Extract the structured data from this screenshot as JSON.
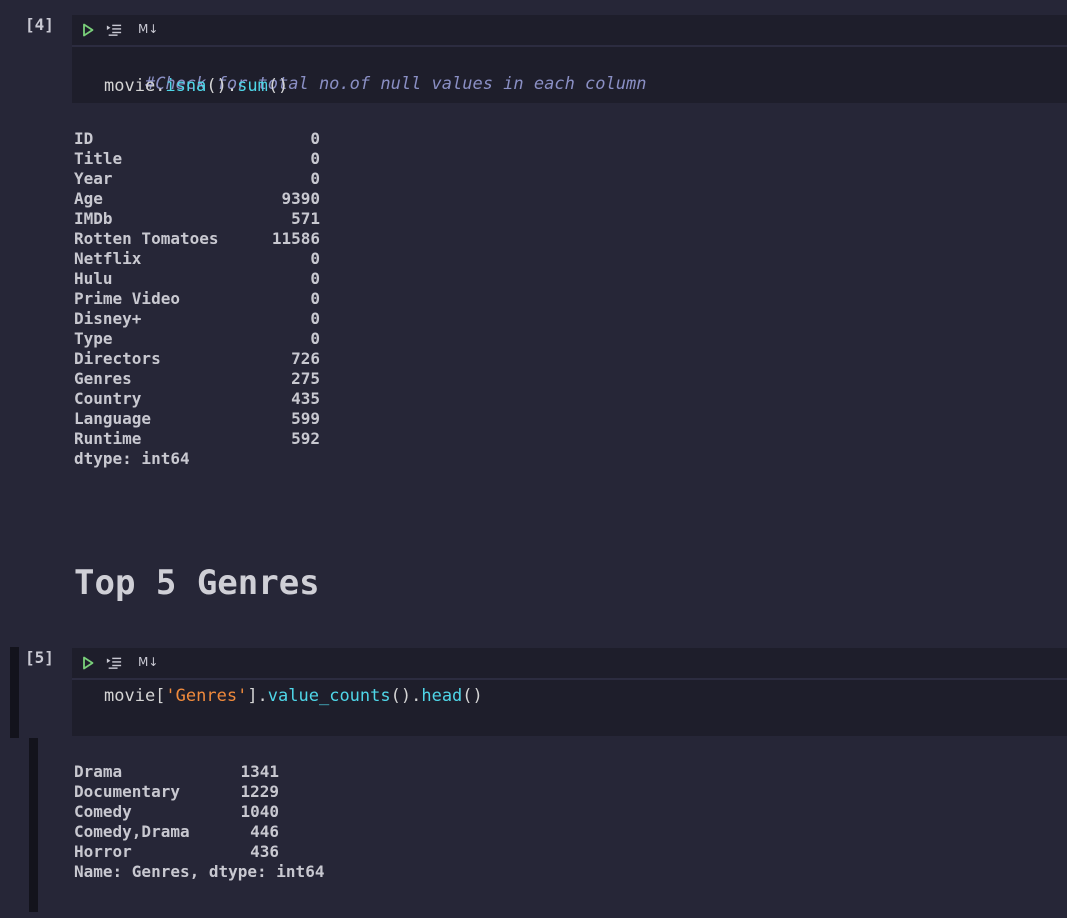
{
  "cells": [
    {
      "prompt": "[4]",
      "toolbar": {
        "md_label": "M↓"
      },
      "code": {
        "comment": "#Check for total no.of null values in each column",
        "line2": {
          "obj": "movie.",
          "fn1": "isna",
          "mid": "().",
          "fn2": "sum",
          "end": "()"
        }
      },
      "output": {
        "rows": [
          {
            "name": "ID",
            "value": "0"
          },
          {
            "name": "Title",
            "value": "0"
          },
          {
            "name": "Year",
            "value": "0"
          },
          {
            "name": "Age",
            "value": "9390"
          },
          {
            "name": "IMDb",
            "value": "571"
          },
          {
            "name": "Rotten Tomatoes",
            "value": "11586"
          },
          {
            "name": "Netflix",
            "value": "0"
          },
          {
            "name": "Hulu",
            "value": "0"
          },
          {
            "name": "Prime Video",
            "value": "0"
          },
          {
            "name": "Disney+",
            "value": "0"
          },
          {
            "name": "Type",
            "value": "0"
          },
          {
            "name": "Directors",
            "value": "726"
          },
          {
            "name": "Genres",
            "value": "275"
          },
          {
            "name": "Country",
            "value": "435"
          },
          {
            "name": "Language",
            "value": "599"
          },
          {
            "name": "Runtime",
            "value": "592"
          }
        ],
        "footer": "dtype: int64"
      }
    },
    {
      "prompt": "[5]",
      "toolbar": {
        "md_label": "M↓"
      },
      "code": {
        "obj": "movie[",
        "str": "'Genres'",
        "mid": "].",
        "fn1": "value_counts",
        "mid2": "().",
        "fn2": "head",
        "end": "()"
      },
      "output": {
        "rows": [
          {
            "name": "Drama",
            "value": "1341"
          },
          {
            "name": "Documentary",
            "value": "1229"
          },
          {
            "name": "Comedy",
            "value": "1040"
          },
          {
            "name": "Comedy,Drama",
            "value": "446"
          },
          {
            "name": "Horror",
            "value": "436"
          }
        ],
        "footer": "Name: Genres, dtype: int64"
      }
    }
  ],
  "markdown": {
    "heading": "Top 5 Genres"
  },
  "icons": {
    "run": "run-icon",
    "run_by_line": "run-by-line-icon"
  },
  "colors": {
    "run_icon": "#7ad07a",
    "comment": "#8a8fc4",
    "function": "#4fd6e8",
    "string": "#f08a3c"
  }
}
